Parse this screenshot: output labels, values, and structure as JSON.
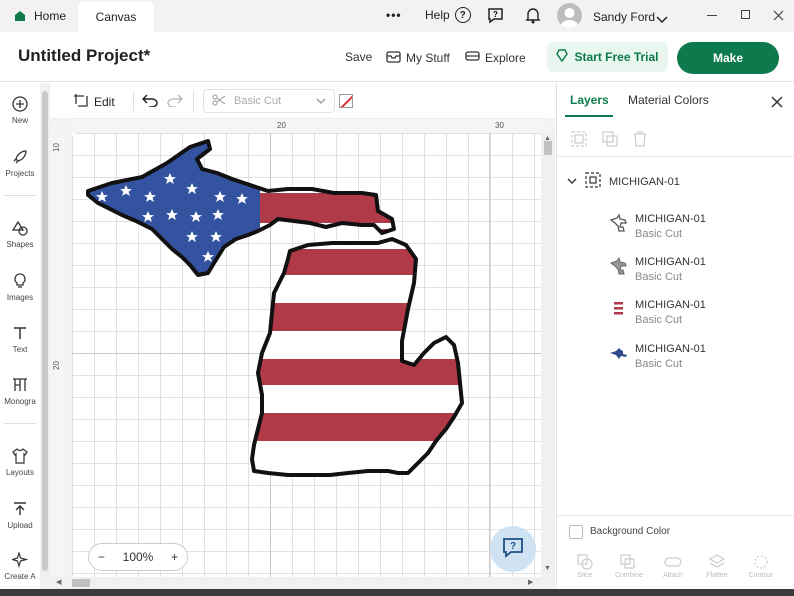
{
  "window": {
    "tabs": [
      {
        "label": "Home"
      },
      {
        "label": "Canvas"
      }
    ],
    "more_menu": "•••",
    "help_label": "Help",
    "user_name": "Sandy Ford"
  },
  "header": {
    "project_title": "Untitled Project*",
    "save_label": "Save",
    "mystuff_label": "My Stuff",
    "explore_label": "Explore",
    "trial_label": "Start Free Trial",
    "make_label": "Make"
  },
  "left_tools": [
    {
      "label": "New",
      "icon": "plus-circle-icon"
    },
    {
      "label": "Projects",
      "icon": "rocket-icon"
    },
    {
      "label": "Shapes",
      "icon": "shapes-icon"
    },
    {
      "label": "Images",
      "icon": "lightbulb-icon"
    },
    {
      "label": "Text",
      "icon": "text-icon"
    },
    {
      "label": "Monogra",
      "icon": "monogram-icon"
    },
    {
      "label": "Layouts",
      "icon": "shirt-icon"
    },
    {
      "label": "Upload",
      "icon": "upload-icon"
    },
    {
      "label": "Create A",
      "icon": "sparkle-icon"
    }
  ],
  "edit_bar": {
    "edit_label": "Edit",
    "operation_value": "Basic Cut"
  },
  "rulers": {
    "top": [
      "20",
      "30"
    ],
    "left": [
      "10",
      "20"
    ]
  },
  "zoom": {
    "minus": "−",
    "value": "100%",
    "plus": "+"
  },
  "right_panel": {
    "tab_layers": "Layers",
    "tab_material": "Material Colors",
    "group_name": "MICHIGAN-01",
    "layers": [
      {
        "name": "MICHIGAN-01",
        "op": "Basic Cut",
        "thumb_color": "#555555"
      },
      {
        "name": "MICHIGAN-01",
        "op": "Basic Cut",
        "thumb_color": "#888888"
      },
      {
        "name": "MICHIGAN-01",
        "op": "Basic Cut",
        "thumb_color": "#b03a48"
      },
      {
        "name": "MICHIGAN-01",
        "op": "Basic Cut",
        "thumb_color": "#2f4a8a"
      }
    ],
    "background_color_label": "Background Color",
    "bottom_tools": [
      "Slice",
      "Combine",
      "Attach",
      "Flatten",
      "Contour"
    ]
  },
  "colors": {
    "brand_green": "#0c7a4d",
    "flag_red": "#b03a48",
    "flag_blue": "#3352a0"
  }
}
